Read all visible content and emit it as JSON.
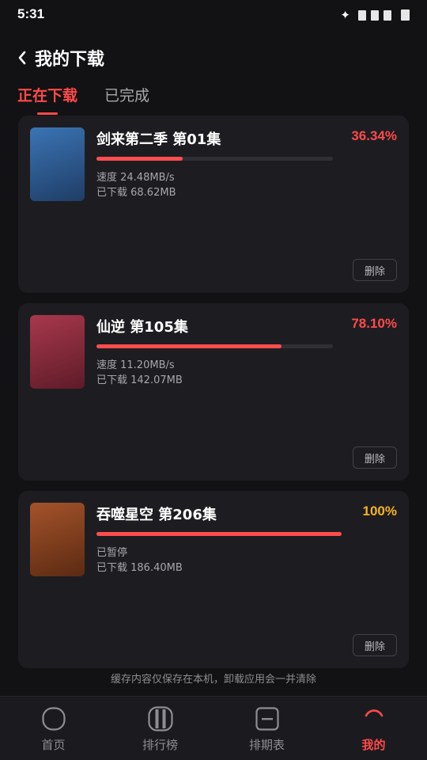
{
  "status_bar": {
    "time": "5:31",
    "icons": [
      "sparkle-icon",
      "signal-icon",
      "signal-icon",
      "signal-icon",
      "battery-icon"
    ]
  },
  "header": {
    "title": "我的下载",
    "back_icon": "chevron-left-icon"
  },
  "tabs": [
    {
      "label": "正在下载",
      "active": true
    },
    {
      "label": "已完成",
      "active": false
    }
  ],
  "downloads": [
    {
      "title": "剑来第二季 第01集",
      "percent": "36.34%",
      "progress": 0.3634,
      "percent_color": "#ff4a4a",
      "line1": "速度 24.48MB/s",
      "line2": "已下载 68.62MB",
      "cover_colors": [
        "#3b74b4",
        "#1f3d66"
      ],
      "delete_label": "删除"
    },
    {
      "title": "仙逆 第105集",
      "percent": "78.10%",
      "progress": 0.781,
      "percent_color": "#ff4a4a",
      "line1": "速度 11.20MB/s",
      "line2": "已下载 142.07MB",
      "cover_colors": [
        "#a8384c",
        "#5e1b28"
      ],
      "delete_label": "删除"
    },
    {
      "title": "吞噬星空 第206集",
      "percent": "100%",
      "progress": 1.0,
      "percent_color": "#f5b323",
      "line1": "已暂停",
      "line2": "已下载 186.40MB",
      "cover_colors": [
        "#a4532a",
        "#5b2a12"
      ],
      "delete_label": "删除"
    }
  ],
  "footer_note": "缓存内容仅保存在本机，卸载应用会一并清除",
  "bottom_nav": [
    {
      "label": "首页",
      "icon": "home-icon",
      "active": false
    },
    {
      "label": "排行榜",
      "icon": "ranking-icon",
      "active": false
    },
    {
      "label": "排期表",
      "icon": "schedule-icon",
      "active": false
    },
    {
      "label": "我的",
      "icon": "profile-icon",
      "active": true
    }
  ],
  "colors": {
    "accent": "#ff4a4a",
    "complete": "#f5b323",
    "card_bg": "#1d1d21",
    "page_bg": "#121214"
  }
}
